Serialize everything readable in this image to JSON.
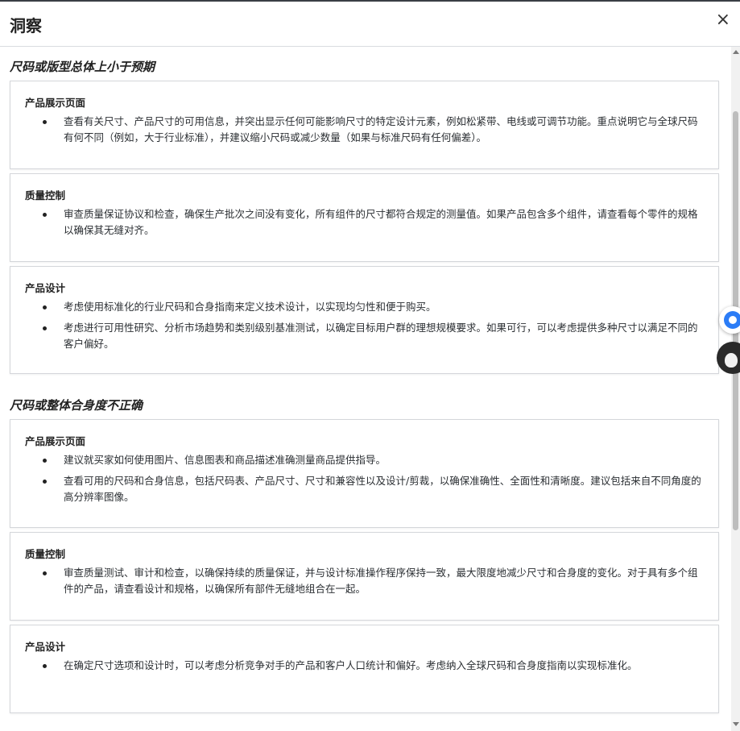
{
  "dialog": {
    "title": "洞察",
    "close_icon": "×"
  },
  "sections": [
    {
      "title": "尺码或版型总体上小于预期",
      "cards": [
        {
          "title": "产品展示页面",
          "bullets": [
            "查看有关尺寸、产品尺寸的可用信息，并突出显示任何可能影响尺寸的特定设计元素，例如松紧带、电线或可调节功能。重点说明它与全球尺码有何不同（例如，大于行业标准），并建议缩小尺码或减少数量（如果与标准尺码有任何偏差）。"
          ]
        },
        {
          "title": "质量控制",
          "bullets": [
            "审查质量保证协议和检查，确保生产批次之间没有变化，所有组件的尺寸都符合规定的测量值。如果产品包含多个组件，请查看每个零件的规格以确保其无缝对齐。"
          ]
        },
        {
          "title": "产品设计",
          "bullets": [
            "考虑使用标准化的行业尺码和合身指南来定义技术设计，以实现均匀性和便于购买。",
            "考虑进行可用性研究、分析市场趋势和类别级别基准测试，以确定目标用户群的理想规模要求。如果可行，可以考虑提供多种尺寸以满足不同的客户偏好。"
          ]
        }
      ]
    },
    {
      "title": "尺码或整体合身度不正确",
      "cards": [
        {
          "title": "产品展示页面",
          "bullets": [
            "建议就买家如何使用图片、信息图表和商品描述准确测量商品提供指导。",
            "查看可用的尺码和合身信息，包括尺码表、产品尺寸、尺寸和兼容性以及设计/剪裁，以确保准确性、全面性和清晰度。建议包括来自不同角度的高分辨率图像。"
          ]
        },
        {
          "title": "质量控制",
          "bullets": [
            "审查质量测试、审计和检查，以确保持续的质量保证，并与设计标准操作程序保持一致，最大限度地减少尺寸和合身度的变化。对于具有多个组件的产品，请查看设计和规格，以确保所有部件无缝地组合在一起。"
          ]
        },
        {
          "title": "产品设计",
          "bullets": [
            "在确定尺寸选项和设计时，可以考虑分析竞争对手的产品和客户人口统计和偏好。考虑纳入全球尺码和合身度指南以实现标准化。"
          ]
        }
      ]
    }
  ]
}
